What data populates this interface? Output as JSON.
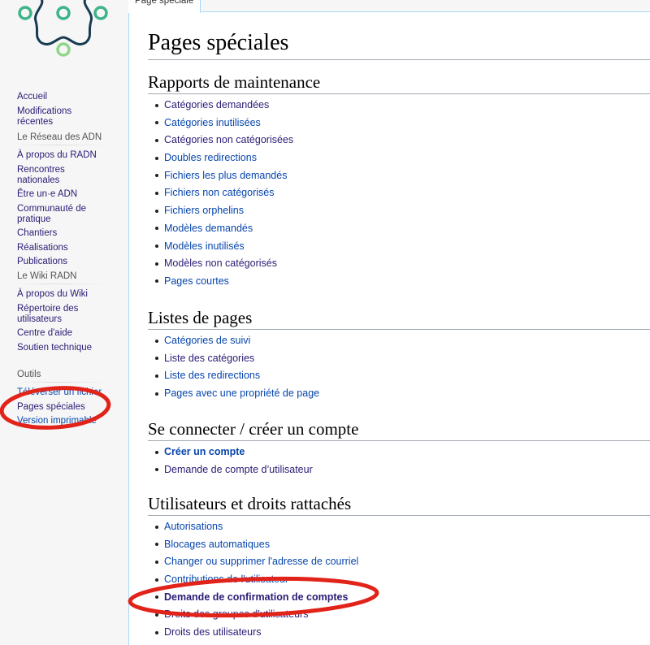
{
  "logo": {
    "name": "radn-logo"
  },
  "tab": {
    "label": "Page spéciale"
  },
  "sidebar": {
    "navigation": [
      {
        "label": "Accueil",
        "state": "visited"
      },
      {
        "label": "Modifications récentes",
        "state": "visited"
      }
    ],
    "portals": [
      {
        "heading": "Le Réseau des ADN",
        "items": [
          {
            "label": "À propos du RADN",
            "state": "visited"
          },
          {
            "label": "Rencontres nationales",
            "state": "visited"
          },
          {
            "label": "Être un·e ADN",
            "state": "visited"
          },
          {
            "label": "Communauté de pratique",
            "state": "visited"
          },
          {
            "label": "Chantiers",
            "state": "visited"
          },
          {
            "label": "Réalisations",
            "state": "visited"
          },
          {
            "label": "Publications",
            "state": "visited"
          }
        ]
      },
      {
        "heading": "Le Wiki RADN",
        "items": [
          {
            "label": "À propos du Wiki",
            "state": "visited"
          },
          {
            "label": "Répertoire des utilisateurs",
            "state": "visited"
          },
          {
            "label": "Centre d'aide",
            "state": "visited"
          },
          {
            "label": "Soutien technique",
            "state": "visited"
          }
        ]
      },
      {
        "heading": "Outils",
        "items": [
          {
            "label": "Téléverser un fichier",
            "state": "unvisited"
          },
          {
            "label": "Pages spéciales",
            "state": "visited"
          },
          {
            "label": "Version imprimable",
            "state": "unvisited"
          }
        ]
      }
    ]
  },
  "page": {
    "title": "Pages spéciales",
    "sections": [
      {
        "heading": "Rapports de maintenance",
        "links": [
          {
            "label": "Catégories demandées",
            "state": "visited"
          },
          {
            "label": "Catégories inutilisées",
            "state": "unvisited"
          },
          {
            "label": "Catégories non catégorisées",
            "state": "visited"
          },
          {
            "label": "Doubles redirections",
            "state": "unvisited"
          },
          {
            "label": "Fichiers les plus demandés",
            "state": "unvisited"
          },
          {
            "label": "Fichiers non catégorisés",
            "state": "unvisited"
          },
          {
            "label": "Fichiers orphelins",
            "state": "unvisited"
          },
          {
            "label": "Modèles demandés",
            "state": "unvisited"
          },
          {
            "label": "Modèles inutilisés",
            "state": "unvisited"
          },
          {
            "label": "Modèles non catégorisés",
            "state": "visited"
          },
          {
            "label": "Pages courtes",
            "state": "unvisited"
          }
        ]
      },
      {
        "heading": "Listes de pages",
        "links": [
          {
            "label": "Catégories de suivi",
            "state": "unvisited"
          },
          {
            "label": "Liste des catégories",
            "state": "visited"
          },
          {
            "label": "Liste des redirections",
            "state": "unvisited"
          },
          {
            "label": "Pages avec une propriété de page",
            "state": "unvisited"
          }
        ]
      },
      {
        "heading": "Se connecter / créer un compte",
        "links": [
          {
            "label": "Créer un compte",
            "state": "unvisited",
            "bold": true
          },
          {
            "label": "Demande de compte d’utilisateur",
            "state": "visited"
          }
        ]
      },
      {
        "heading": "Utilisateurs et droits rattachés",
        "links": [
          {
            "label": "Autorisations",
            "state": "unvisited"
          },
          {
            "label": "Blocages automatiques",
            "state": "unvisited"
          },
          {
            "label": "Changer ou supprimer l'adresse de courriel",
            "state": "unvisited"
          },
          {
            "label": "Contributions de l'utilisateur",
            "state": "unvisited"
          },
          {
            "label": "Demande de confirmation de comptes",
            "state": "visited",
            "bold": true
          },
          {
            "label": "Droits des groupes d'utilisateurs",
            "state": "visited"
          },
          {
            "label": "Droits des utilisateurs",
            "state": "visited"
          }
        ]
      }
    ]
  },
  "annotations": {
    "highlight_color": "#e2231a"
  }
}
